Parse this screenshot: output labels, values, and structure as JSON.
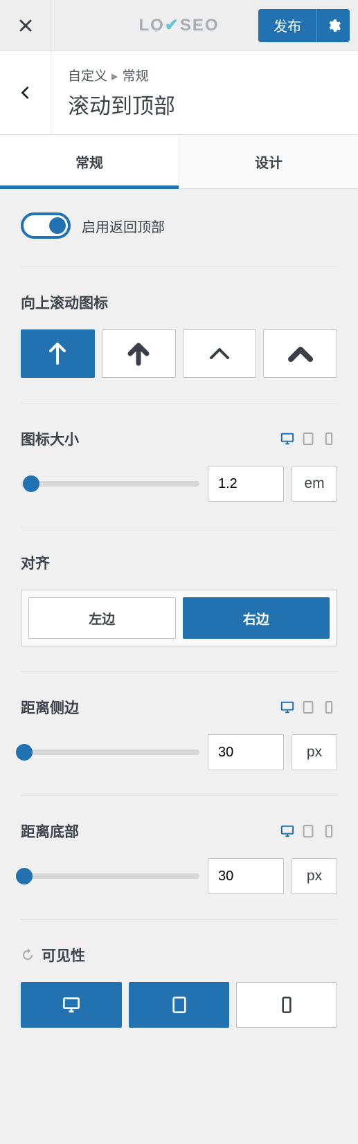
{
  "topbar": {
    "logo_pre": "LO",
    "logo_post": "SEO",
    "publish": "发布"
  },
  "breadcrumb": {
    "parent": "自定义",
    "current": "常规"
  },
  "title": "滚动到顶部",
  "tabs": {
    "general": "常规",
    "design": "设计"
  },
  "toggle": {
    "label": "启用返回顶部"
  },
  "icon_section": {
    "title": "向上滚动图标"
  },
  "size_section": {
    "title": "图标大小",
    "value": "1.2",
    "unit": "em",
    "slider_pos": "6%"
  },
  "align_section": {
    "title": "对齐",
    "left": "左边",
    "right": "右边"
  },
  "side_section": {
    "title": "距离侧边",
    "value": "30",
    "unit": "px",
    "slider_pos": "2%"
  },
  "bottom_section": {
    "title": "距离底部",
    "value": "30",
    "unit": "px",
    "slider_pos": "2%"
  },
  "visibility": {
    "title": "可见性"
  }
}
